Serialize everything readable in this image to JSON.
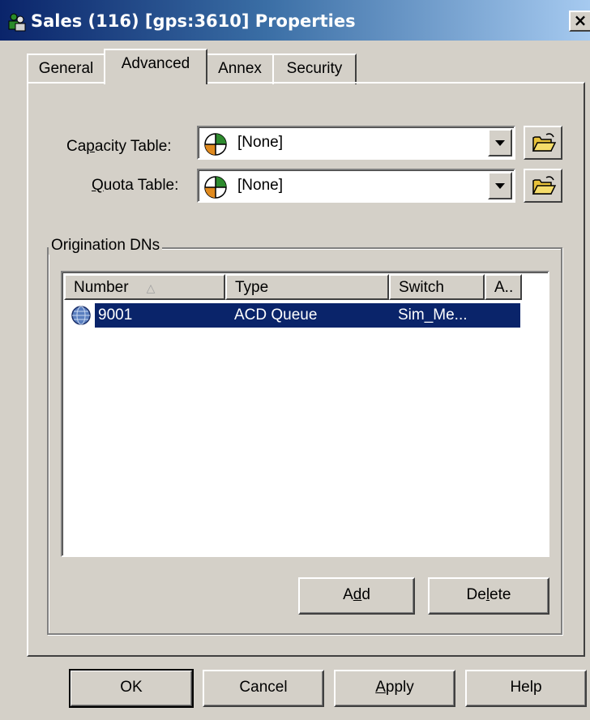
{
  "window": {
    "title": "Sales (116) [gps:3610] Properties",
    "close_label": "×"
  },
  "tabs": [
    {
      "label": "General"
    },
    {
      "label": "Advanced",
      "active": true
    },
    {
      "label": "Annex"
    },
    {
      "label": "Security"
    }
  ],
  "capacity": {
    "pre": "Ca",
    "u": "p",
    "post": "acity Table:",
    "value": "[None]"
  },
  "quota": {
    "u": "Q",
    "post": "uota Table:",
    "value": "[None]"
  },
  "origination": {
    "title": "Origination DNs",
    "columns": [
      "Number",
      "Type",
      "Switch",
      "A.."
    ],
    "rows": [
      {
        "number": "9001",
        "type": "ACD Queue",
        "switch": "Sim_Me..."
      }
    ],
    "add": {
      "pre": "A",
      "u": "d",
      "post": "d"
    },
    "delete": {
      "pre": "De",
      "u": "l",
      "post": "ete"
    }
  },
  "buttons": {
    "ok": "OK",
    "cancel": "Cancel",
    "apply": {
      "u": "A",
      "post": "pply"
    },
    "help": "Help"
  },
  "colors": {
    "selection": "#0a246a",
    "face": "#d4d0c8"
  }
}
